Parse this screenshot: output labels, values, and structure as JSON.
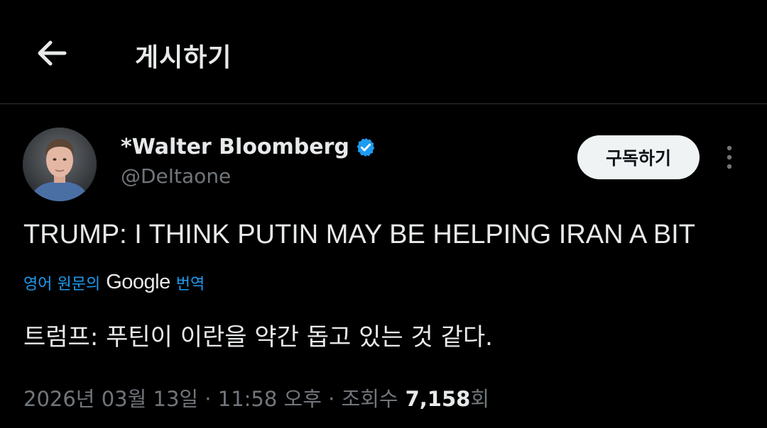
{
  "header": {
    "title": "게시하기",
    "back_icon": "arrow-left-icon"
  },
  "author": {
    "display_name": "*Walter Bloomberg",
    "handle": "@DeItaone",
    "verified_icon": "verified-badge-icon",
    "verified_color": "#1d9bf0"
  },
  "actions": {
    "subscribe_label": "구독하기",
    "more_icon": "more-vertical-icon"
  },
  "tweet": {
    "text": "TRUMP: I THINK PUTIN MAY BE HELPING IRAN A BIT",
    "translate_prefix": "영어 원문의",
    "translate_brand": "Google",
    "translate_suffix": "번역",
    "translated_text": "트럼프: 푸틴이 이란을 약간 돕고 있는 것 같다."
  },
  "meta": {
    "date": "2026년 03월 13일",
    "separator": " · ",
    "time": "11:58 오후",
    "views_label": "조회수",
    "views_count": "7,158",
    "views_suffix": "회"
  },
  "colors": {
    "background": "#000000",
    "text_primary": "#e7e9ea",
    "text_secondary": "#71767b",
    "accent": "#1d9bf0",
    "divider": "#2f3336"
  }
}
